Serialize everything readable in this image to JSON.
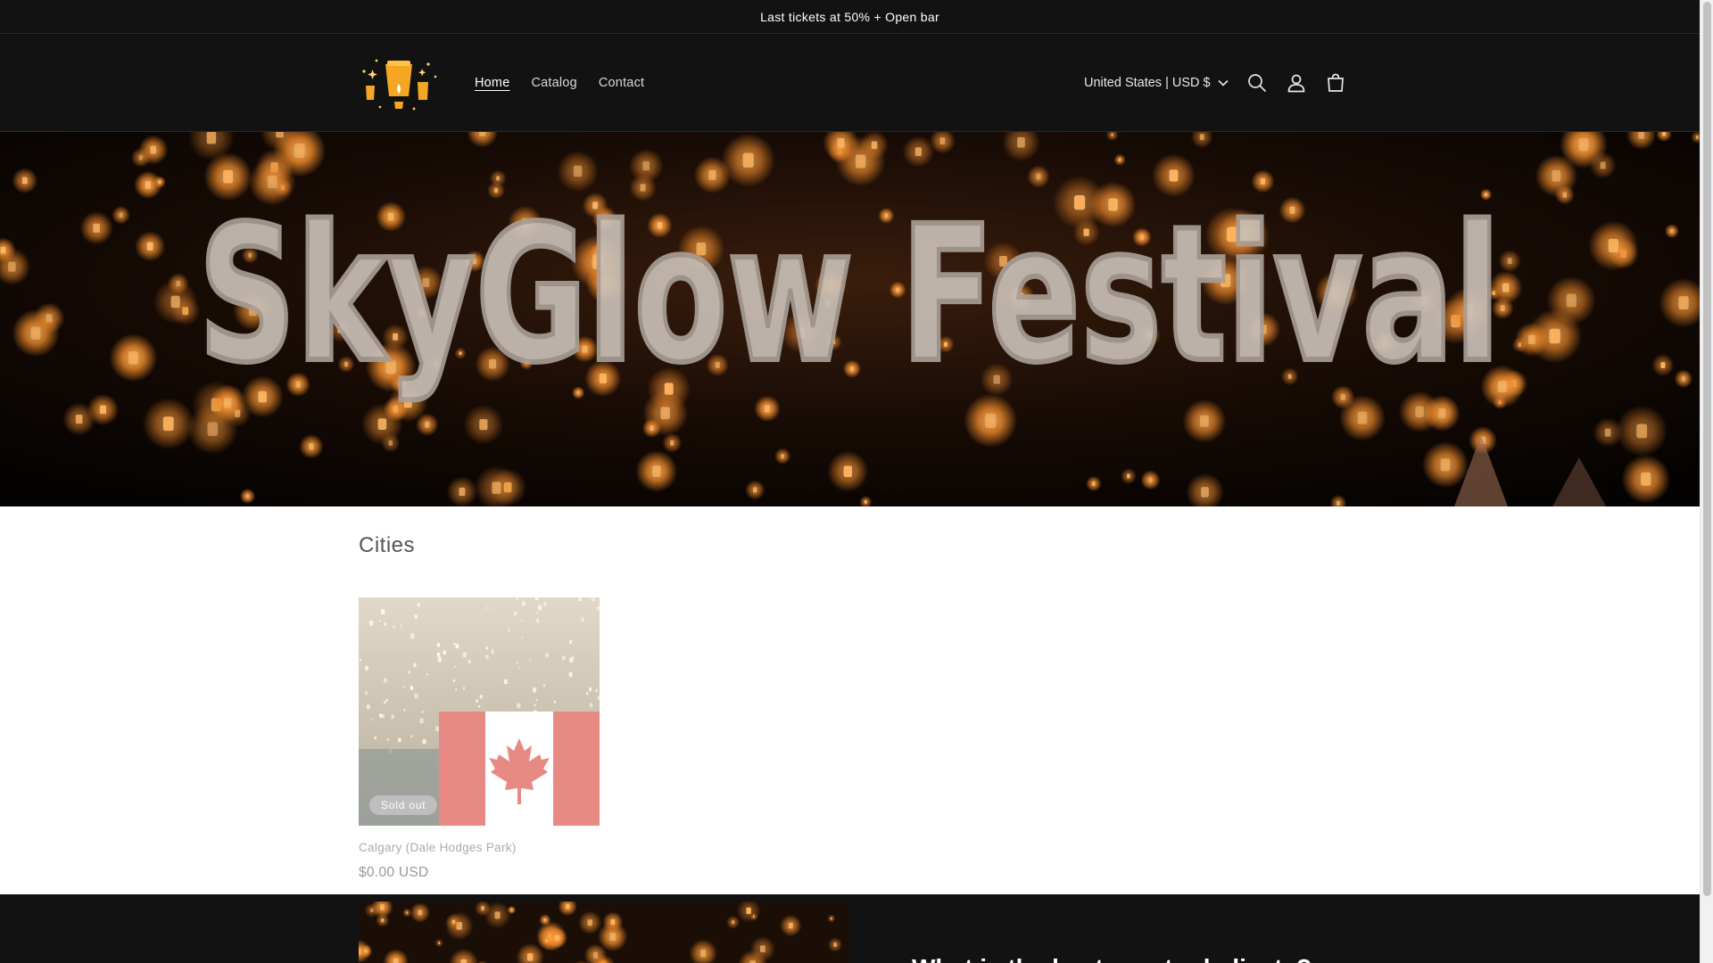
{
  "announcement": {
    "text": "Last tickets at 50% + Open bar"
  },
  "header": {
    "logo_icon": "sky-lantern-logo",
    "nav": [
      {
        "label": "Home",
        "active": true
      },
      {
        "label": "Catalog",
        "active": false
      },
      {
        "label": "Contact",
        "active": false
      }
    ],
    "currency_label": "United States | USD $",
    "icons": [
      "search-icon",
      "account-icon",
      "cart-icon"
    ]
  },
  "hero": {
    "title": "SkyGlow Festival"
  },
  "cities": {
    "heading": "Cities",
    "products": [
      {
        "title": "Calgary (Dale Hodges Park)",
        "price": "$0.00 USD",
        "badge": "Sold out"
      }
    ]
  },
  "next_section": {
    "heading": "What is the best way to dedicate?"
  },
  "colors": {
    "dark": "#121212",
    "accent": "#f5a623",
    "flag_red": "#d52b1e"
  }
}
